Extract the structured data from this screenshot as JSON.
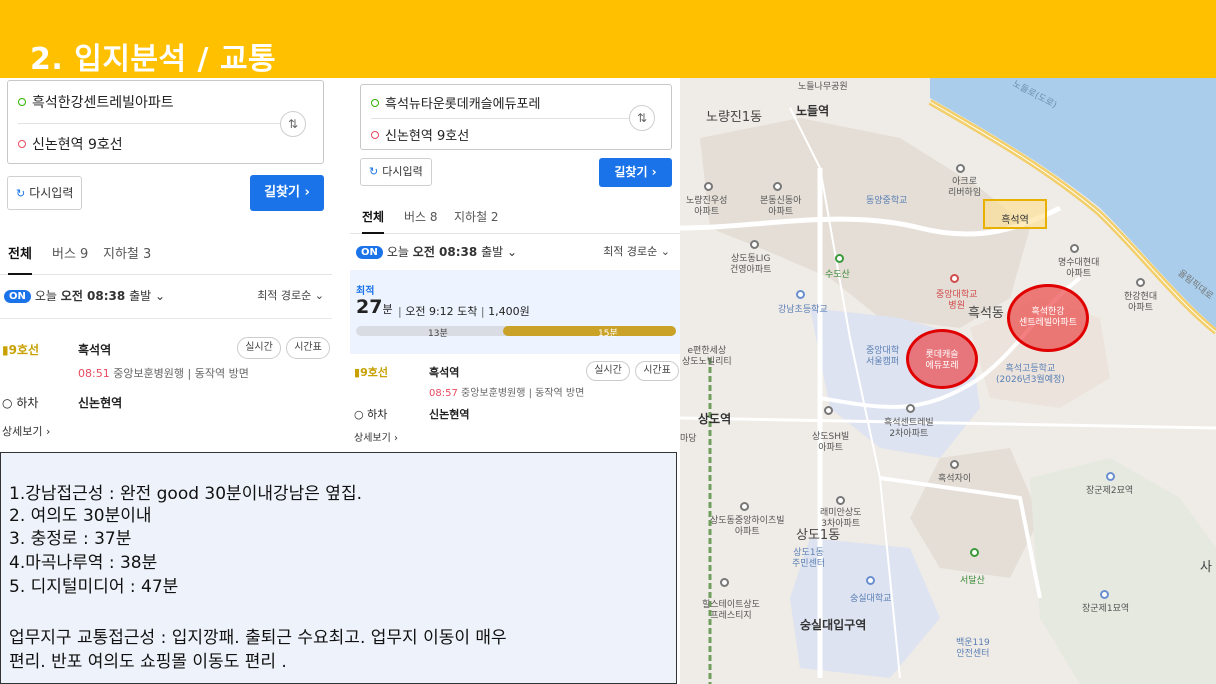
{
  "header": {
    "title": "2. 입지분석 / 교통"
  },
  "colors": {
    "header_bg": "#ffc000",
    "search_btn": "#1a73e8",
    "line9": "#c8a000",
    "highlight": "#e00000"
  },
  "panel1": {
    "origin": "흑석한강센트레빌아파트",
    "destination": "신논현역 9호선",
    "swap_icon": "swap-icon",
    "reset_label": "다시입력",
    "search_label": "길찾기 ›",
    "tabs": [
      "전체",
      "버스 9",
      "지하철 3"
    ],
    "on_badge": "ON",
    "depart_prefix": "오늘",
    "depart_time": "오전 08:38",
    "depart_suffix": "출발 ⌄",
    "sort_label": "최적 경로순 ⌄",
    "line_label": "9호선",
    "station": "흑석역",
    "realtime_label": "실시간",
    "timetable_label": "시간표",
    "train_time": "08:51",
    "train_desc": "중앙보훈병원행 | 동작역 방면",
    "alight_label": "하차",
    "alight_station": "신논현역",
    "detail_label": "상세보기 ›"
  },
  "panel2": {
    "origin": "흑석뉴타운롯데캐슬에듀포레",
    "destination": "신논현역 9호선",
    "reset_label": "다시입력",
    "search_label": "길찾기 ›",
    "tabs": [
      "전체",
      "버스 8",
      "지하철 2"
    ],
    "on_badge": "ON",
    "depart_prefix": "오늘",
    "depart_time": "오전 08:38",
    "depart_suffix": "출발 ⌄",
    "sort_label": "최적 경로순 ⌄",
    "best_label": "최적",
    "duration_num": "27",
    "duration_unit": "분",
    "arrive_text": "오전 9:12 도착",
    "fare": "1,400원",
    "walk_minutes": "13분",
    "ride_minutes": "15분",
    "ride_fraction": 0.54,
    "line_label": "9호선",
    "station": "흑석역",
    "realtime_label": "실시간",
    "timetable_label": "시간표",
    "train_time": "08:57",
    "train_desc": "중앙보훈병원행 | 동작역 방면",
    "alight_label": "하차",
    "alight_station": "신논현역",
    "detail_label": "상세보기 ›"
  },
  "notes": {
    "lines": [
      "1.강남접근성 : 완전 good 30분이내강남은  옆집.",
      "2. 여의도  30분이내",
      "3. 충정로 : 37분",
      "4.마곡나루역   : 38분",
      "5. 디지털미디어   : 47분",
      "",
      "업무지구 교통접근성 : 입지깡패. 출퇴근 수요최고. 업무지 이동이 매우",
      "편리. 반포 여의도 쇼핑몰 이동도 편리 ."
    ]
  },
  "map": {
    "labels": {
      "noryangjin1": "노량진1동",
      "noryangjin_park": "노들나무공원",
      "nodeul_st": "노들역",
      "noryangjin_woosung": "노량진우성\n아파트",
      "bondong_sindonga": "본동신동아\n아파트",
      "dongyang_ms": "동양중학교",
      "acro_river": "아크로\n리버하임",
      "heukseok_st": "흑석역",
      "myungsu_apt": "명수대현대\n아파트",
      "sangdo_lig": "상도동LIG\n건영아파트",
      "sudosan": "수도산",
      "cau_hospital": "중앙대학교\n병원",
      "gangnam_ms": "강남초등학교",
      "heukseok_dong": "흑석동",
      "hangang_hyundai": "한강현대\n아파트",
      "circle1": "흑석한강\n센트레빌아파트",
      "circle2": "롯데캐슬\n에듀포레",
      "cau": "중앙대학\n서울캠퍼",
      "heukseok_hs": "흑석고등학교\n(2026년3월예정)",
      "sangdo_nobilly": "e편한세상\n상도노빌리티",
      "sangdo_st": "상도역",
      "madang": "마당",
      "sangdo_sh": "상도SH빌\n아파트",
      "centreville2": "흑석센트레빌\n2차아파트",
      "heukseok_xi": "흑석자이",
      "janggun2": "장군제2묘역",
      "raemian_sangdo": "래미안상도\n3차아파트",
      "sangdo_central": "상도동중앙하이츠빌\n아파트",
      "sangdo1dong": "상도1동",
      "sangdo1_center": "상도1동\n주민센터",
      "seodalsan": "서달산",
      "hillstate": "힐스테이트상도\n프레스티지",
      "soongsil_ms": "숭실대학교",
      "soongsil_st": "숭실대입구역",
      "janggun1": "장군제1묘역",
      "baekun119": "백운119\n안전센터",
      "olympic_road": "올림픽대로",
      "river_road": "노들로(도로)",
      "sa": "사"
    }
  }
}
